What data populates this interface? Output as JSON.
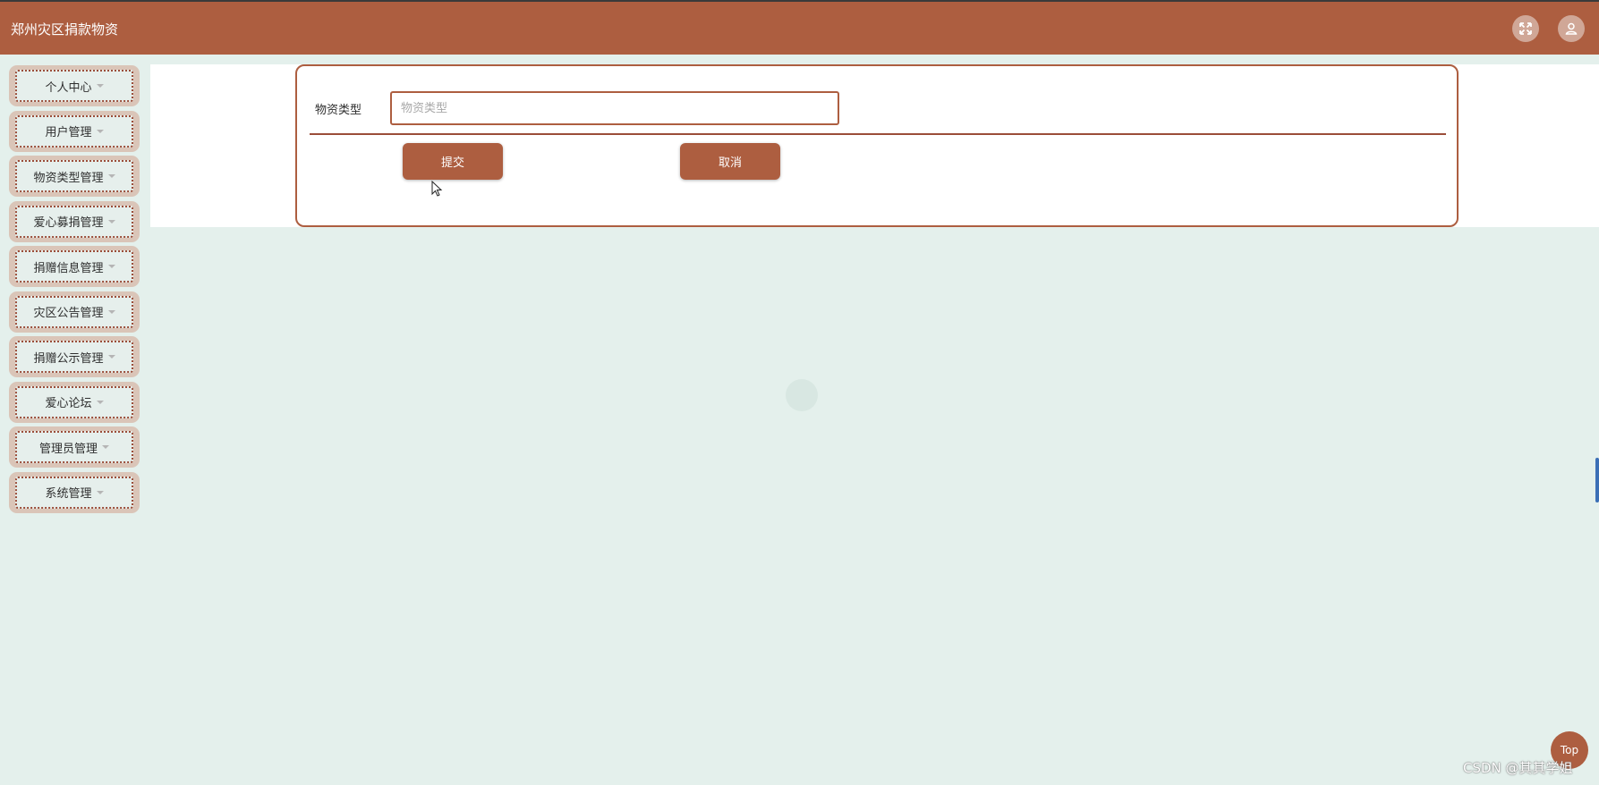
{
  "header": {
    "title": "郑州灾区捐款物资",
    "fullscreen_icon": "fullscreen-icon",
    "user_icon": "user-icon"
  },
  "sidebar": {
    "items": [
      {
        "label": "个人中心"
      },
      {
        "label": "用户管理"
      },
      {
        "label": "物资类型管理"
      },
      {
        "label": "爱心募捐管理"
      },
      {
        "label": "捐赠信息管理"
      },
      {
        "label": "灾区公告管理"
      },
      {
        "label": "捐赠公示管理"
      },
      {
        "label": "爱心论坛"
      },
      {
        "label": "管理员管理"
      },
      {
        "label": "系统管理"
      }
    ]
  },
  "form": {
    "field_label": "物资类型",
    "field_placeholder": "物资类型",
    "field_value": "",
    "submit_label": "提交",
    "cancel_label": "取消"
  },
  "footer": {
    "top_label": "Top",
    "watermark": "CSDN @其其学姐"
  },
  "colors": {
    "accent": "#ad5e40",
    "background": "#e4f0ec"
  }
}
